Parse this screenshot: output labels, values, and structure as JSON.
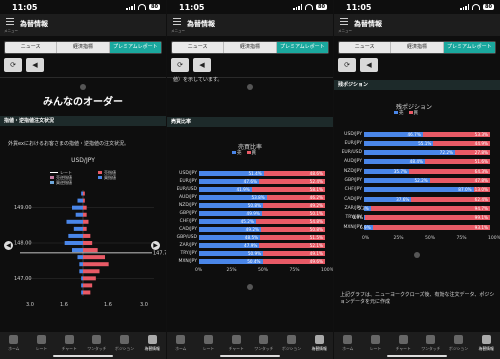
{
  "status": {
    "time": "11:05",
    "battery": "80"
  },
  "header": {
    "title": "為替情報",
    "menu_label": "メニュー"
  },
  "tabs": [
    {
      "label": "ニュース"
    },
    {
      "label": "経済指標"
    },
    {
      "label": "プレミアムレポート"
    }
  ],
  "nav": [
    {
      "label": "ホーム"
    },
    {
      "label": "レート"
    },
    {
      "label": "チャート"
    },
    {
      "label": "ワンタッチ"
    },
    {
      "label": "ポジション"
    },
    {
      "label": "為替情報"
    }
  ],
  "screen1": {
    "big_title": "みんなのオーダー",
    "section": "指値・逆指値注文状況",
    "intro": "外貨exにおけるお客さまの指値・逆指値の注文状況。",
    "chart_title": "USD/JPY",
    "legend": [
      "レート",
      "売逆指値",
      "買逆指値",
      "売指値",
      "買指値"
    ],
    "price_marker": "147.72",
    "colors": {
      "buy": "#4a86e8",
      "sell": "#e85a66",
      "buy_stop": "#6fa8dc",
      "sell_stop": "#c27ba0"
    }
  },
  "screen2": {
    "text": "値）を示しています。",
    "section": "売買比率",
    "chart_title": "売買比率",
    "legend": [
      "売",
      "買"
    ]
  },
  "screen3": {
    "section": "残ポジション",
    "chart_title": "残ポジション",
    "legend": [
      "売",
      "買"
    ],
    "note": "上記グラフは、ニューヨーククローズ後、有効な注文データ、ポジションデータを元に作成"
  },
  "chart_data": [
    {
      "type": "bar",
      "title": "USD/JPY",
      "ylabel": "",
      "yticks": [
        "149.00",
        "148.00",
        "147.00"
      ],
      "xticks": [
        "3.0",
        "1.6",
        "1.6",
        "3.0"
      ],
      "current_rate": 147.72,
      "bins": [
        {
          "price": 149.4,
          "buy": 0.1,
          "sell": 0.1
        },
        {
          "price": 149.2,
          "buy": 0.3,
          "sell": 0.1
        },
        {
          "price": 149.0,
          "buy": 0.6,
          "sell": 0.2
        },
        {
          "price": 148.8,
          "buy": 0.4,
          "sell": 0.2
        },
        {
          "price": 148.6,
          "buy": 0.9,
          "sell": 0.3
        },
        {
          "price": 148.4,
          "buy": 0.5,
          "sell": 0.2
        },
        {
          "price": 148.2,
          "buy": 0.8,
          "sell": 0.4
        },
        {
          "price": 148.0,
          "buy": 1.0,
          "sell": 0.5
        },
        {
          "price": 147.8,
          "buy": 0.6,
          "sell": 0.8
        },
        {
          "price": 147.6,
          "buy": 0.3,
          "sell": 1.2
        },
        {
          "price": 147.4,
          "buy": 0.2,
          "sell": 1.4
        },
        {
          "price": 147.2,
          "buy": 0.2,
          "sell": 0.9
        },
        {
          "price": 147.0,
          "buy": 0.1,
          "sell": 0.7
        },
        {
          "price": 146.8,
          "buy": 0.1,
          "sell": 0.5
        },
        {
          "price": 146.6,
          "buy": 0.1,
          "sell": 0.4
        }
      ]
    },
    {
      "type": "bar",
      "title": "売買比率",
      "xticks": [
        "0%",
        "25%",
        "50%",
        "75%",
        "100%"
      ],
      "categories": [
        "USD/JPY",
        "EUR/JPY",
        "EUR/USD",
        "AUD/JPY",
        "NZD/JPY",
        "GBP/JPY",
        "CHF/JPY",
        "CAD/JPY",
        "GBP/USD",
        "ZAR/JPY",
        "TRY/JPY",
        "MXN/JPY"
      ],
      "series": [
        {
          "name": "売",
          "values": [
            51.4,
            47.6,
            41.9,
            53.8,
            50.8,
            49.9,
            45.2,
            49.2,
            48.5,
            47.9,
            50.9,
            50.4
          ]
        },
        {
          "name": "買",
          "values": [
            48.6,
            52.4,
            58.1,
            46.2,
            49.2,
            50.1,
            54.8,
            50.8,
            51.5,
            52.1,
            49.1,
            49.6
          ]
        }
      ]
    },
    {
      "type": "bar",
      "title": "残ポジション",
      "xticks": [
        "0%",
        "25%",
        "50%",
        "75%",
        "100%"
      ],
      "categories": [
        "USD/JPY",
        "EUR/JPY",
        "EUR/USD",
        "AUD/JPY",
        "NZD/JPY",
        "GBP/JPY",
        "CHF/JPY",
        "CAD/JPY",
        "ZAR/JPY",
        "TRY/JPY",
        "MXN/JPY"
      ],
      "series": [
        {
          "name": "売",
          "values": [
            46.7,
            55.1,
            72.2,
            48.4,
            35.7,
            52.2,
            87.0,
            37.6,
            5.3,
            0.9,
            6.9
          ]
        },
        {
          "name": "買",
          "values": [
            53.3,
            44.9,
            27.8,
            51.6,
            64.3,
            47.8,
            13.0,
            62.4,
            94.7,
            99.1,
            93.1
          ]
        }
      ]
    }
  ]
}
